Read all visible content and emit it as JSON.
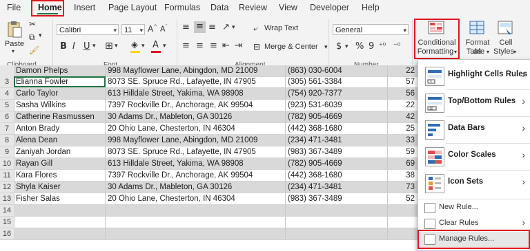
{
  "menu": {
    "tabs": [
      "File",
      "Home",
      "Insert",
      "Page Layout",
      "Formulas",
      "Data",
      "Review",
      "View",
      "Developer",
      "Help"
    ],
    "active": "Home"
  },
  "ribbon": {
    "paste_label": "Paste",
    "font_name": "Calibri",
    "font_size": "11",
    "wrap_text": "Wrap Text",
    "merge_center": "Merge & Center",
    "number_format": "General",
    "currency": "$",
    "percent": "%",
    "comma": "9",
    "conditional_formatting_line1": "Conditional",
    "conditional_formatting_line2": "Formatting",
    "format_as_table_line1": "Format as",
    "format_as_table_line2": "Table",
    "cell_styles_line1": "Cell",
    "cell_styles_line2": "Styles",
    "groups": {
      "clipboard": "Clipboard",
      "font": "Font",
      "alignment": "Alignment",
      "number": "Number"
    }
  },
  "rows": [
    {
      "num": "",
      "name": "Damon Phelps",
      "address": "998 Mayflower Lane, Abingdon, MD 21009",
      "phone": "(863) 030-6004",
      "age": "22"
    },
    {
      "num": "3",
      "name": "Elianna Fowler",
      "address": "8073 SE. Spruce Rd., Lafayette, IN 47905",
      "phone": "(305) 561-3384",
      "age": "57"
    },
    {
      "num": "4",
      "name": "Carlo Taylor",
      "address": "613 Hilldale Street, Yakima, WA 98908",
      "phone": "(754) 920-7377",
      "age": "56"
    },
    {
      "num": "5",
      "name": "Sasha Wilkins",
      "address": "7397 Rockville Dr., Anchorage, AK 99504",
      "phone": "(923) 531-6039",
      "age": "22"
    },
    {
      "num": "6",
      "name": "Catherine Rasmussen",
      "address": "30 Adams Dr., Mableton, GA 30126",
      "phone": "(782) 905-4669",
      "age": "42"
    },
    {
      "num": "7",
      "name": "Anton Brady",
      "address": "20 Ohio Lane, Chesterton, IN 46304",
      "phone": "(442) 368-1680",
      "age": "25"
    },
    {
      "num": "8",
      "name": "Alena Dean",
      "address": "998 Mayflower Lane, Abingdon, MD 21009",
      "phone": "(234) 471-3481",
      "age": "33"
    },
    {
      "num": "9",
      "name": "Zaniyah Jordan",
      "address": "8073 SE. Spruce Rd., Lafayette, IN 47905",
      "phone": "(983) 367-3489",
      "age": "59"
    },
    {
      "num": "10",
      "name": "Rayan Gill",
      "address": "613 Hilldale Street, Yakima, WA 98908",
      "phone": "(782) 905-4669",
      "age": "69"
    },
    {
      "num": "11",
      "name": "Kara Flores",
      "address": "7397 Rockville Dr., Anchorage, AK 99504",
      "phone": "(442) 368-1680",
      "age": "38"
    },
    {
      "num": "12",
      "name": "Shyla Kaiser",
      "address": "30 Adams Dr., Mableton, GA 30126",
      "phone": "(234) 471-3481",
      "age": "73"
    },
    {
      "num": "13",
      "name": "Fisher Salas",
      "address": "20 Ohio Lane, Chesterton, IN 46304",
      "phone": "(983) 367-3489",
      "age": "52"
    },
    {
      "num": "14",
      "name": "",
      "address": "",
      "phone": "",
      "age": ""
    },
    {
      "num": "15",
      "name": "",
      "address": "",
      "phone": "",
      "age": ""
    },
    {
      "num": "16",
      "name": "",
      "address": "",
      "phone": "",
      "age": ""
    }
  ],
  "dropdown": {
    "items": [
      {
        "label": "Highlight Cells Rules",
        "icon": "highlight-cells-icon"
      },
      {
        "label": "Top/Bottom Rules",
        "icon": "top-bottom-icon"
      },
      {
        "label": "Data Bars",
        "icon": "data-bars-icon"
      },
      {
        "label": "Color Scales",
        "icon": "color-scales-icon"
      },
      {
        "label": "Icon Sets",
        "icon": "icon-sets-icon"
      }
    ],
    "new_rule": "New Rule...",
    "clear_rules": "Clear Rules",
    "manage_rules": "Manage Rules..."
  },
  "colors": {
    "accent": "#217346",
    "highlight_box": "#e0141e",
    "row_shade": "#d9d9d9"
  }
}
